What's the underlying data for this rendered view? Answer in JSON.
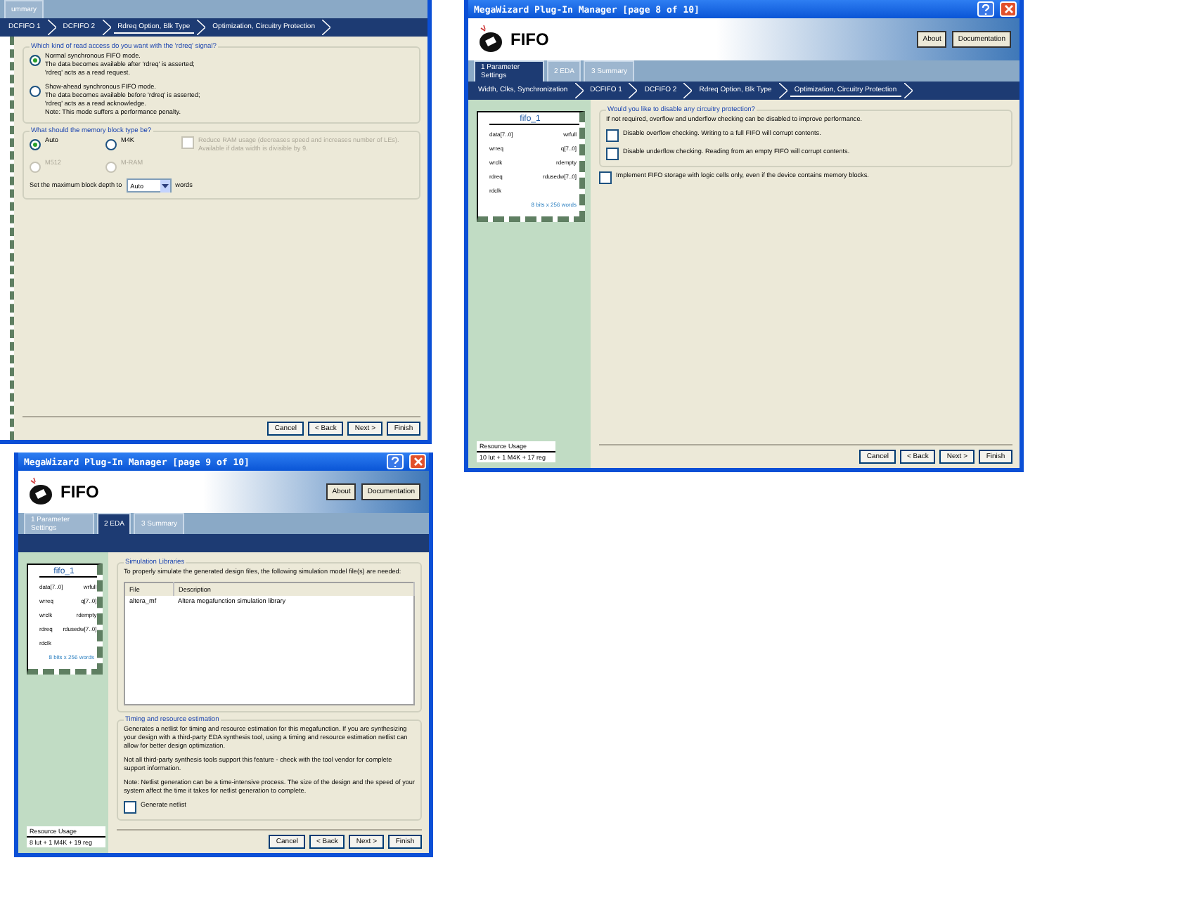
{
  "windows": [
    {
      "tabs": [
        {
          "label": "ummary",
          "selected": false
        }
      ],
      "breadcrumbs": [
        {
          "label": "DCFIFO 1",
          "selected": false
        },
        {
          "label": "DCFIFO 2",
          "selected": false
        },
        {
          "label": "Rdreq Option, Blk Type",
          "selected": true
        },
        {
          "label": "Optimization, Circuitry Protection",
          "selected": false
        }
      ],
      "content": [
        {
          "kind": "group",
          "title": "Which kind of read access do you want with the 'rdreq' signal?",
          "children": [
            {
              "kind": "radio",
              "lines": [
                "Normal synchronous FIFO mode.",
                "The data becomes available after 'rdreq' is asserted;",
                "'rdreq' acts as a read request."
              ],
              "selected": true,
              "disabled": false
            },
            {
              "kind": "radio",
              "lines": [
                "Show-ahead synchronous FIFO mode.",
                "The data becomes available before 'rdreq' is asserted;",
                "'rdreq' acts as a read acknowledge.",
                "Note: This mode suffers a performance penalty."
              ],
              "selected": false,
              "disabled": false
            }
          ]
        },
        {
          "kind": "group",
          "title": "What should the memory block type be?",
          "children": [
            {
              "kind": "columns",
              "columns": [
                [
                  {
                    "kind": "radio",
                    "lines": [
                      "Auto"
                    ],
                    "selected": true,
                    "disabled": false
                  },
                  {
                    "kind": "radio",
                    "lines": [
                      "M512"
                    ],
                    "selected": false,
                    "disabled": true
                  }
                ],
                [
                  {
                    "kind": "radio",
                    "lines": [
                      "M4K"
                    ],
                    "selected": false,
                    "disabled": false
                  },
                  {
                    "kind": "radio",
                    "lines": [
                      "M-RAM"
                    ],
                    "selected": false,
                    "disabled": true
                  }
                ],
                [
                  {
                    "kind": "checkbox",
                    "label": "Reduce RAM usage (decreases speed and increases number of LEs). Available if data width is divisible by 9.",
                    "checked": false,
                    "disabled": true
                  }
                ]
              ]
            },
            {
              "kind": "select",
              "before": "Set the maximum block depth to",
              "value": "Auto",
              "after": "words"
            }
          ]
        }
      ],
      "buttons": [
        "Cancel",
        "< Back",
        "Next >",
        "Finish"
      ]
    },
    {
      "title": "MegaWizard Plug-In Manager [page 8 of 10]",
      "header": {
        "product": "FIFO",
        "buttons": [
          "About",
          "Documentation"
        ]
      },
      "tabs": [
        {
          "label": "1 Parameter Settings",
          "selected": true
        },
        {
          "label": "2 EDA",
          "selected": false
        },
        {
          "label": "3 Summary",
          "selected": false
        }
      ],
      "breadcrumbs": [
        {
          "label": "Width, Clks, Synchronization",
          "selected": false
        },
        {
          "label": "DCFIFO 1",
          "selected": false
        },
        {
          "label": "DCFIFO 2",
          "selected": false
        },
        {
          "label": "Rdreq Option, Blk Type",
          "selected": false
        },
        {
          "label": "Optimization, Circuitry Protection",
          "selected": true
        }
      ],
      "sidebar": {
        "symbol": {
          "title": "fifo_1",
          "inputs": [
            "data[7..0]",
            "wrreq",
            "wrclk",
            "rdreq",
            "rdclk"
          ],
          "outputs": [
            "wrfull",
            "q[7..0]",
            "rdempty",
            "rdusedw[7..0]"
          ],
          "note": "8 bits x 256 words"
        },
        "resource": {
          "title": "Resource Usage",
          "value": "10 lut + 1 M4K + 17 reg"
        }
      },
      "content": [
        {
          "kind": "group",
          "title": "Would you like to disable any circuitry protection?",
          "children": [
            {
              "kind": "text",
              "text": "If not required, overflow and underflow checking can be disabled to improve performance."
            },
            {
              "kind": "checkbox",
              "label": "Disable overflow checking. Writing to a full FIFO will corrupt contents.",
              "checked": false,
              "disabled": false
            },
            {
              "kind": "checkbox",
              "label": "Disable underflow checking. Reading from an empty FIFO will corrupt contents.",
              "checked": false,
              "disabled": false
            }
          ]
        },
        {
          "kind": "checkbox",
          "label": "Implement FIFO storage with logic cells only, even if the device contains memory blocks.",
          "checked": false,
          "disabled": false
        }
      ],
      "buttons": [
        "Cancel",
        "< Back",
        "Next >",
        "Finish"
      ]
    },
    {
      "title": "MegaWizard Plug-In Manager [page 9 of 10]",
      "header": {
        "product": "FIFO",
        "buttons": [
          "About",
          "Documentation"
        ]
      },
      "tabs": [
        {
          "label": "1 Parameter Settings",
          "selected": false
        },
        {
          "label": "2 EDA",
          "selected": true
        },
        {
          "label": "3 Summary",
          "selected": false
        }
      ],
      "sidebar": {
        "symbol": {
          "title": "fifo_1",
          "inputs": [
            "data[7..0]",
            "wrreq",
            "wrclk",
            "rdreq",
            "rdclk"
          ],
          "outputs": [
            "wrfull",
            "q[7..0]",
            "rdempty",
            "rdusedw[7..0]"
          ],
          "note": "8 bits x 256 words"
        },
        "resource": {
          "title": "Resource Usage",
          "value": "8 lut + 1 M4K + 19 reg"
        }
      },
      "content": [
        {
          "kind": "group",
          "title": "Simulation Libraries",
          "children": [
            {
              "kind": "text",
              "text": "To properly simulate the generated design files, the following simulation model file(s) are needed:"
            },
            {
              "kind": "table",
              "columns": [
                "File",
                "Description"
              ],
              "rows": [
                [
                  "altera_mf",
                  "Altera megafunction simulation library"
                ]
              ]
            }
          ]
        },
        {
          "kind": "group",
          "title": "Timing and resource estimation",
          "children": [
            {
              "kind": "text",
              "text": "Generates a netlist for timing and resource estimation for this megafunction. If you are synthesizing your design with a third-party EDA synthesis tool, using a timing and resource estimation netlist can allow for better design optimization."
            },
            {
              "kind": "text",
              "text": "Not all third-party synthesis tools support this feature - check with the tool vendor for complete support information."
            },
            {
              "kind": "text",
              "text": "Note: Netlist generation can be a time-intensive process. The size of the design and the speed of your system affect the time it takes for netlist generation to complete."
            },
            {
              "kind": "checkbox",
              "label": "Generate netlist",
              "checked": false,
              "disabled": false
            }
          ]
        }
      ],
      "buttons": [
        "Cancel",
        "< Back",
        "Next >",
        "Finish"
      ]
    }
  ]
}
